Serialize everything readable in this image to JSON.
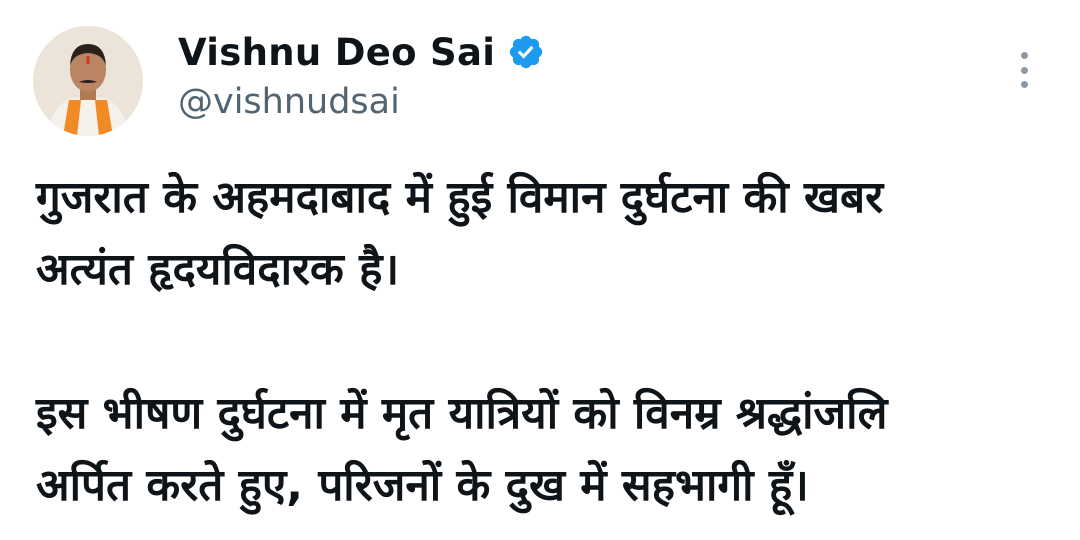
{
  "author": {
    "display_name": "Vishnu Deo Sai",
    "handle": "@vishnudsai",
    "avatar_icon": "profile-photo",
    "verified_icon": "verified-badge-icon",
    "verified_color": "#1d9bf0"
  },
  "menu": {
    "icon": "more-vertical-icon"
  },
  "tweet": {
    "paragraph1": {
      "line1": "गुजरात के अहमदाबाद में हुई विमान दुर्घटना की खबर",
      "line2": "अत्यंत हृदयविदारक है।"
    },
    "paragraph2": {
      "line1": "इस भीषण दुर्घटना में मृत यात्रियों को विनम्र श्रद्धांजलि",
      "line2": "अर्पित करते हुए, परिजनों के दुख में सहभागी हूँ।"
    }
  },
  "colors": {
    "text_primary": "#0f1419",
    "text_secondary": "#536471",
    "background": "#ffffff",
    "accent_saffron": "#f08a24"
  }
}
